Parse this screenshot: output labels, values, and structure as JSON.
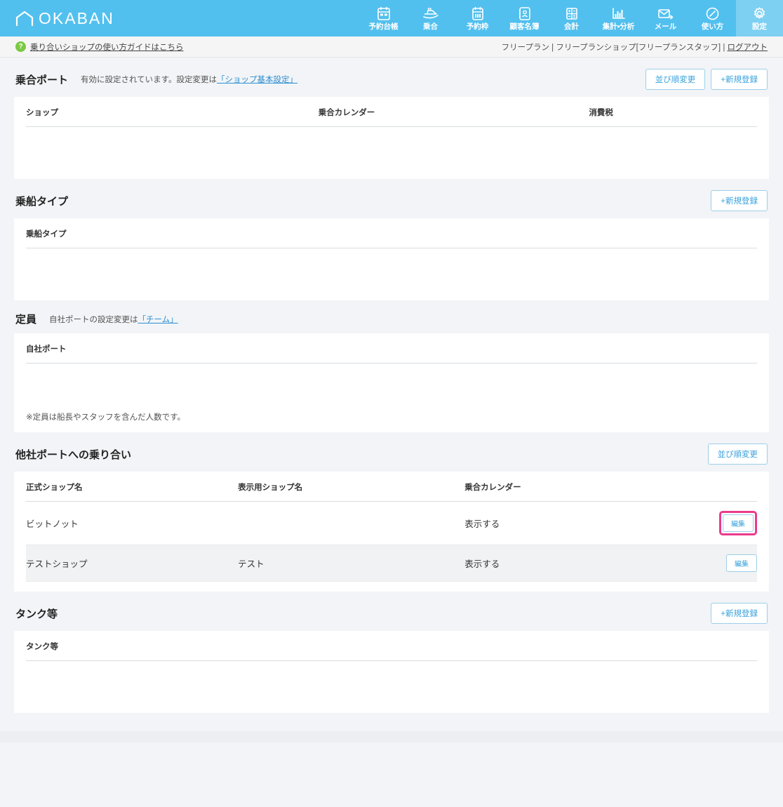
{
  "brand": {
    "name": "OKABAN",
    "logo_icon": "house-outline-icon"
  },
  "topnav": {
    "items": [
      {
        "label": "予約台帳",
        "icon": "calendar-ledger-icon",
        "active": false
      },
      {
        "label": "乗合",
        "icon": "boat-icon",
        "active": false
      },
      {
        "label": "予約枠",
        "icon": "calendar-slot-icon",
        "active": false
      },
      {
        "label": "顧客名簿",
        "icon": "contact-book-icon",
        "active": false
      },
      {
        "label": "会計",
        "icon": "accounting-grid-icon",
        "active": false
      },
      {
        "label": "集計・分析",
        "icon": "bar-chart-icon",
        "active": false
      },
      {
        "label": "メール",
        "icon": "mail-send-icon",
        "active": false
      },
      {
        "label": "使い方",
        "icon": "compass-icon",
        "active": false
      },
      {
        "label": "設定",
        "icon": "gear-icon",
        "active": true
      }
    ],
    "accent_color": "#52c0ef",
    "active_color": "#7ed0f2"
  },
  "subbar": {
    "help_badge": "?",
    "help_link": "乗り合いショップの使い方ガイドはこちら",
    "account_text": "フリープラン | フリープランショップ[フリープランスタッフ] | ",
    "logout_label": "ログアウト"
  },
  "sections": [
    {
      "id": "joint-port",
      "title": "乗合ポート",
      "note_before": "有効に設定されています。設定変更は",
      "note_link": "「ショップ基本設定」",
      "buttons": [
        {
          "label": "並び順変更",
          "name": "reorder-button"
        },
        {
          "label": "+新規登録",
          "name": "new-register-button"
        }
      ],
      "columns": [
        "ショップ",
        "乗合カレンダー",
        "消費税"
      ],
      "rows": []
    },
    {
      "id": "boarding-type",
      "title": "乗船タイプ",
      "note_before": "",
      "note_link": "",
      "buttons": [
        {
          "label": "+新規登録",
          "name": "new-register-button"
        }
      ],
      "columns": [
        "乗船タイプ"
      ],
      "rows": []
    },
    {
      "id": "capacity",
      "title": "定員",
      "note_before": "自社ポートの設定変更は",
      "note_link": "「チーム」",
      "buttons": [],
      "columns": [
        "自社ポート"
      ],
      "rows": [],
      "footnote": "※定員は船長やスタッフを含んだ人数です。"
    },
    {
      "id": "other-company-port",
      "title": "他社ポートへの乗り合い",
      "note_before": "",
      "note_link": "",
      "buttons": [
        {
          "label": "並び順変更",
          "name": "reorder-button"
        }
      ],
      "columns": [
        "正式ショップ名",
        "表示用ショップ名",
        "乗合カレンダー",
        ""
      ],
      "rows": [
        {
          "official_name": "ビットノット",
          "display_name": "",
          "calendar": "表示する",
          "action": "編集",
          "highlighted": true
        },
        {
          "official_name": "テストショップ",
          "display_name": "テスト",
          "calendar": "表示する",
          "action": "編集",
          "highlighted": false
        }
      ]
    },
    {
      "id": "tank",
      "title": "タンク等",
      "note_before": "",
      "note_link": "",
      "buttons": [
        {
          "label": "+新規登録",
          "name": "new-register-button"
        }
      ],
      "columns": [
        "タンク等"
      ],
      "rows": []
    }
  ],
  "colors": {
    "page_bg": "#f2f4f7",
    "panel_bg": "#ffffff",
    "header_blue": "#52c0ef",
    "link_blue": "#2e8fd1",
    "button_blue": "#3ba3dd",
    "highlight_pink": "#ec3a8b",
    "help_green": "#7ac943"
  }
}
